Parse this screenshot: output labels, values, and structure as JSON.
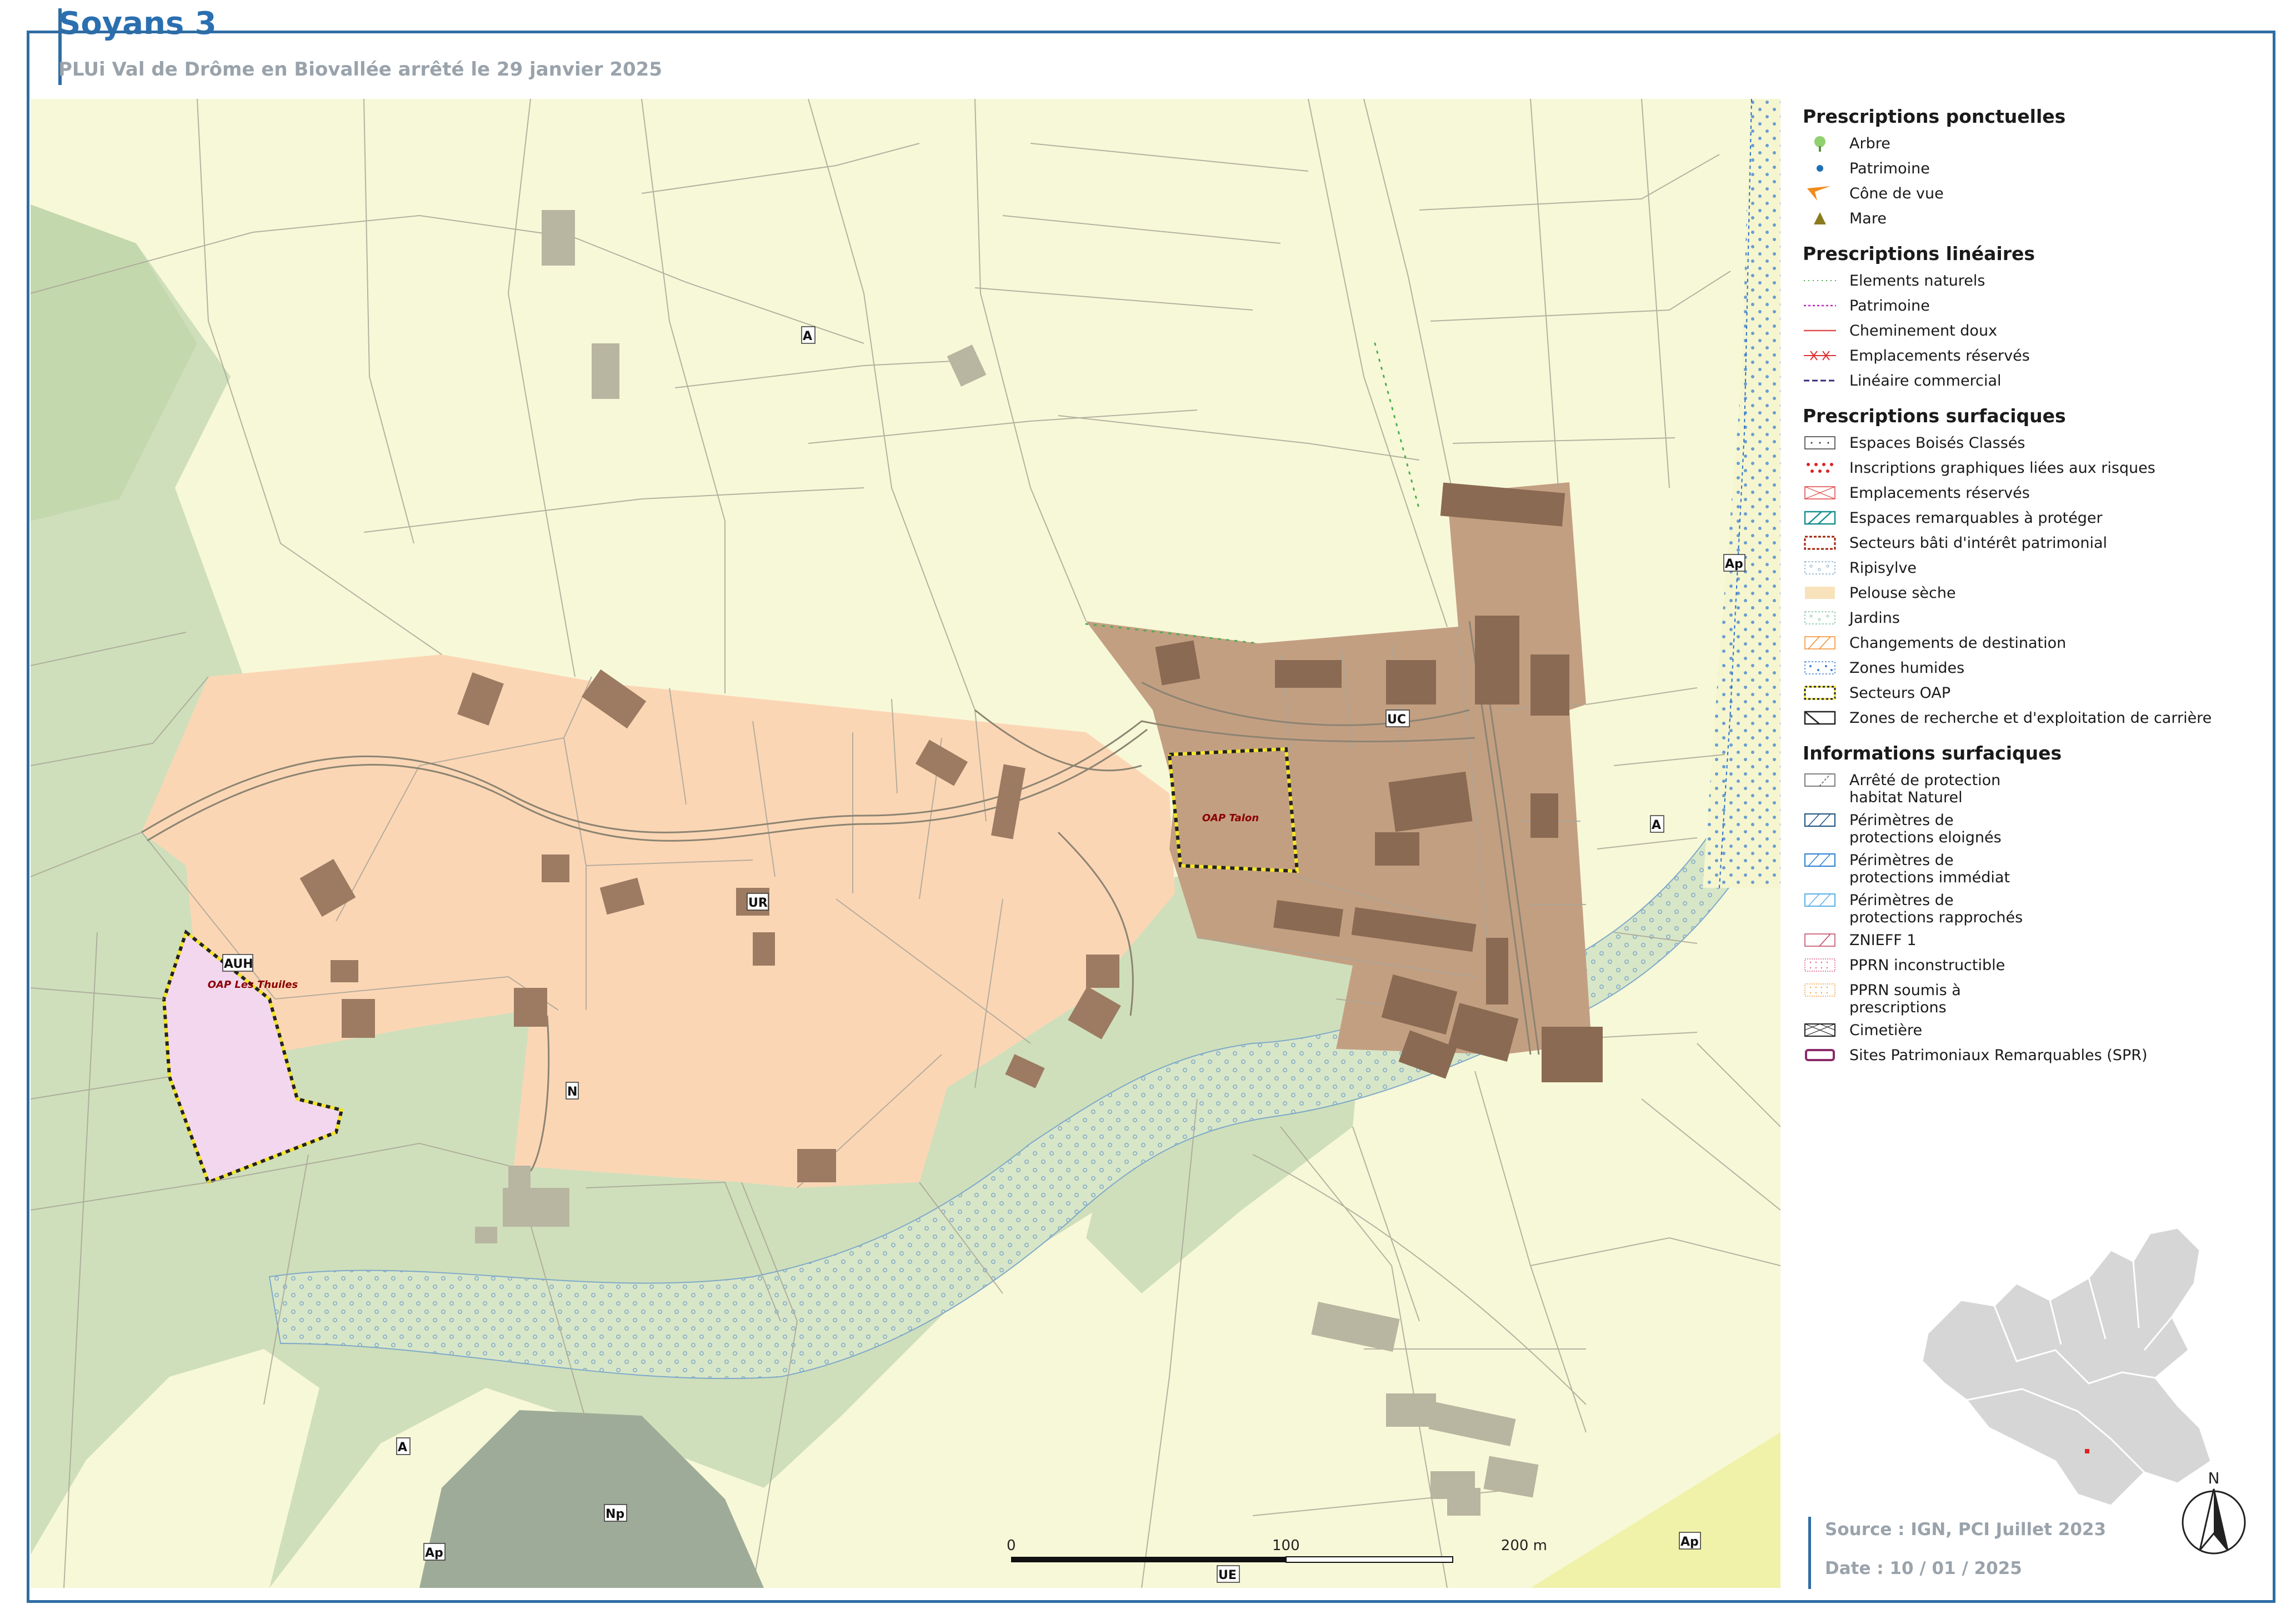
{
  "header": {
    "title": "Soyans 3",
    "subtitle": "PLUi Val de Drôme en Biovallée arrêté le 29 janvier 2025"
  },
  "map": {
    "zones": {
      "a1": "A",
      "a2": "A",
      "a3": "A",
      "ap1": "Ap",
      "ap2": "Ap",
      "ap3": "Ap",
      "ur": "UR",
      "uc": "UC",
      "n": "N",
      "np": "Np",
      "auh": "AUH",
      "ue": "UE"
    },
    "oap_labels": {
      "talon": "OAP Talon",
      "thuiles": "OAP Les Thuiles"
    },
    "colors": {
      "agricultural": "#f7f8d8",
      "natural": "#cfdfbb",
      "natural_dark": "#b9cf9f",
      "ur_zone": "#fbd6b5",
      "uc_zone": "#c39f82",
      "auh_zone": "#f2d7ef",
      "np_zone": "#9eab98",
      "building_uc": "#8a6a52",
      "building_other": "#b8b5a0"
    }
  },
  "legend": {
    "ponctuelles": {
      "title": "Prescriptions ponctuelles",
      "items": [
        {
          "label": "Arbre",
          "icon": "tree-icon"
        },
        {
          "label": "Patrimoine",
          "icon": "dot-icon"
        },
        {
          "label": "Cône de vue",
          "icon": "view-cone-icon"
        },
        {
          "label": "Mare",
          "icon": "triangle-icon"
        }
      ]
    },
    "lineaires": {
      "title": "Prescriptions linéaires",
      "items": [
        {
          "label": "Elements naturels"
        },
        {
          "label": "Patrimoine"
        },
        {
          "label": "Cheminement doux"
        },
        {
          "label": "Emplacements réservés"
        },
        {
          "label": "Linéaire commercial"
        }
      ]
    },
    "surfaciques": {
      "title": "Prescriptions surfaciques",
      "items": [
        {
          "label": "Espaces Boisés Classés"
        },
        {
          "label": "Inscriptions graphiques liées aux risques"
        },
        {
          "label": "Emplacements réservés"
        },
        {
          "label": "Espaces remarquables à protéger"
        },
        {
          "label": "Secteurs bâti d'intérêt patrimonial"
        },
        {
          "label": "Ripisylve"
        },
        {
          "label": "Pelouse sèche"
        },
        {
          "label": "Jardins"
        },
        {
          "label": "Changements de destination"
        },
        {
          "label": "Zones humides"
        },
        {
          "label": "Secteurs OAP"
        },
        {
          "label": "Zones de recherche et d'exploitation de carrière"
        }
      ]
    },
    "informations": {
      "title": "Informations surfaciques",
      "items": [
        {
          "line1": "Arrêté de protection",
          "line2": "habitat Naturel"
        },
        {
          "line1": "Périmètres de",
          "line2": "protections eloignés"
        },
        {
          "line1": "Périmètres de",
          "line2": "protections immédiat"
        },
        {
          "line1": "Périmètres de",
          "line2": "protections rapprochés"
        },
        {
          "line1": "ZNIEFF 1",
          "line2": ""
        },
        {
          "line1": "PPRN inconstructible",
          "line2": ""
        },
        {
          "line1": "PPRN soumis à",
          "line2": "prescriptions"
        },
        {
          "line1": "Cimetière",
          "line2": ""
        },
        {
          "line1": "Sites Patrimoniaux Remarquables (SPR)",
          "line2": ""
        }
      ]
    }
  },
  "scale": {
    "zero": "0",
    "mid": "100",
    "end": "200 m"
  },
  "north_label": "N",
  "footer": {
    "source": "Source : IGN, PCI Juillet 2023",
    "date": "Date : 10 / 01 / 2025"
  }
}
